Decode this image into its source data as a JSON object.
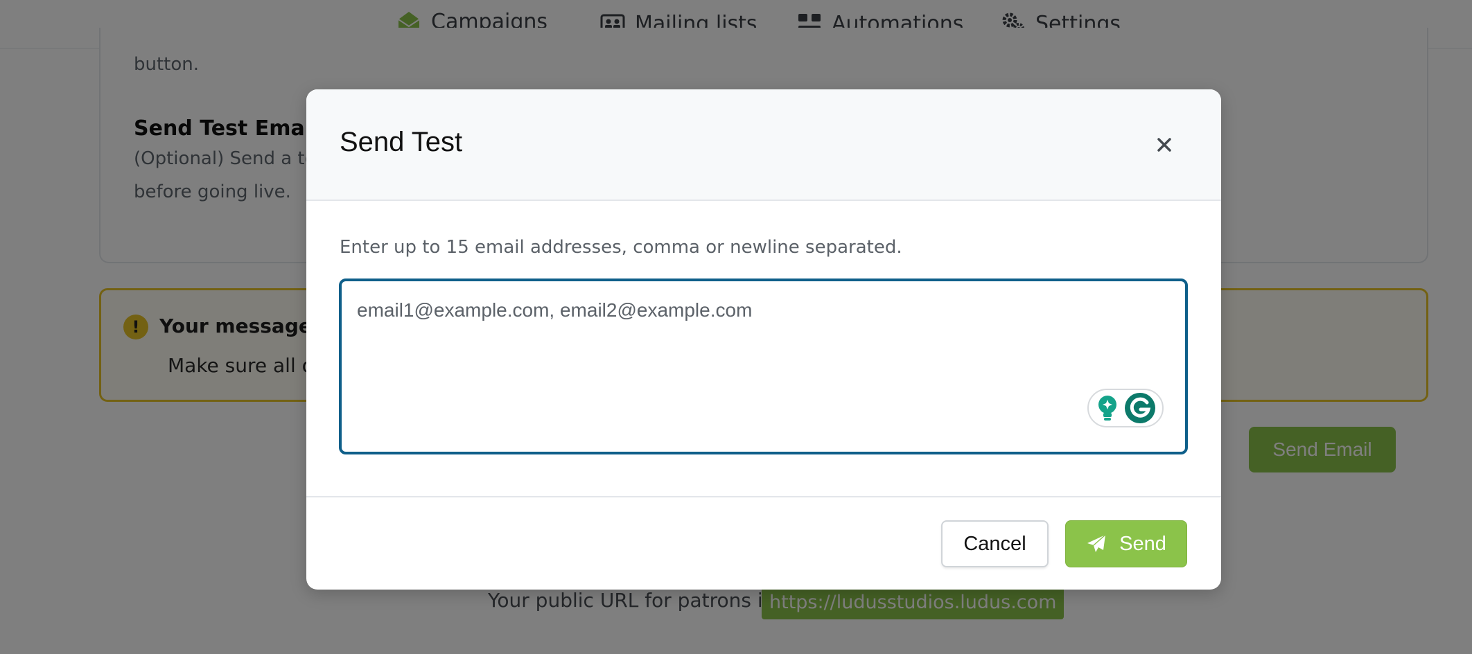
{
  "nav": {
    "items": [
      {
        "label": "Campaigns",
        "icon": "envelope-open-icon",
        "active": true
      },
      {
        "label": "Mailing lists",
        "icon": "address-card-icon",
        "active": false
      },
      {
        "label": "Automations",
        "icon": "network-icon",
        "active": false
      },
      {
        "label": "Settings",
        "icon": "gears-icon",
        "active": false
      }
    ]
  },
  "background": {
    "card_text_top": "button.",
    "send_test_heading": "Send Test Email",
    "send_test_desc_line1": "(Optional) Send a te",
    "send_test_desc_line2": "before going live.",
    "warning_title": "Your message w",
    "warning_text": "Make sure all of",
    "send_email_button": "Send Email",
    "public_url_label": "Your public URL for patrons is:",
    "public_url_link": "https://ludusstudios.ludus.com"
  },
  "modal": {
    "title": "Send Test",
    "close_symbol": "×",
    "description": "Enter up to 15 email addresses, comma or newline separated.",
    "email_placeholder": "email1@example.com, email2@example.com",
    "email_value": "",
    "cancel_label": "Cancel",
    "send_label": "Send"
  },
  "colors": {
    "accent_green": "#8bc34a",
    "input_border": "#0f5f8a",
    "warning_yellow": "#e6c227",
    "grammarly_teal": "#15a38a"
  }
}
